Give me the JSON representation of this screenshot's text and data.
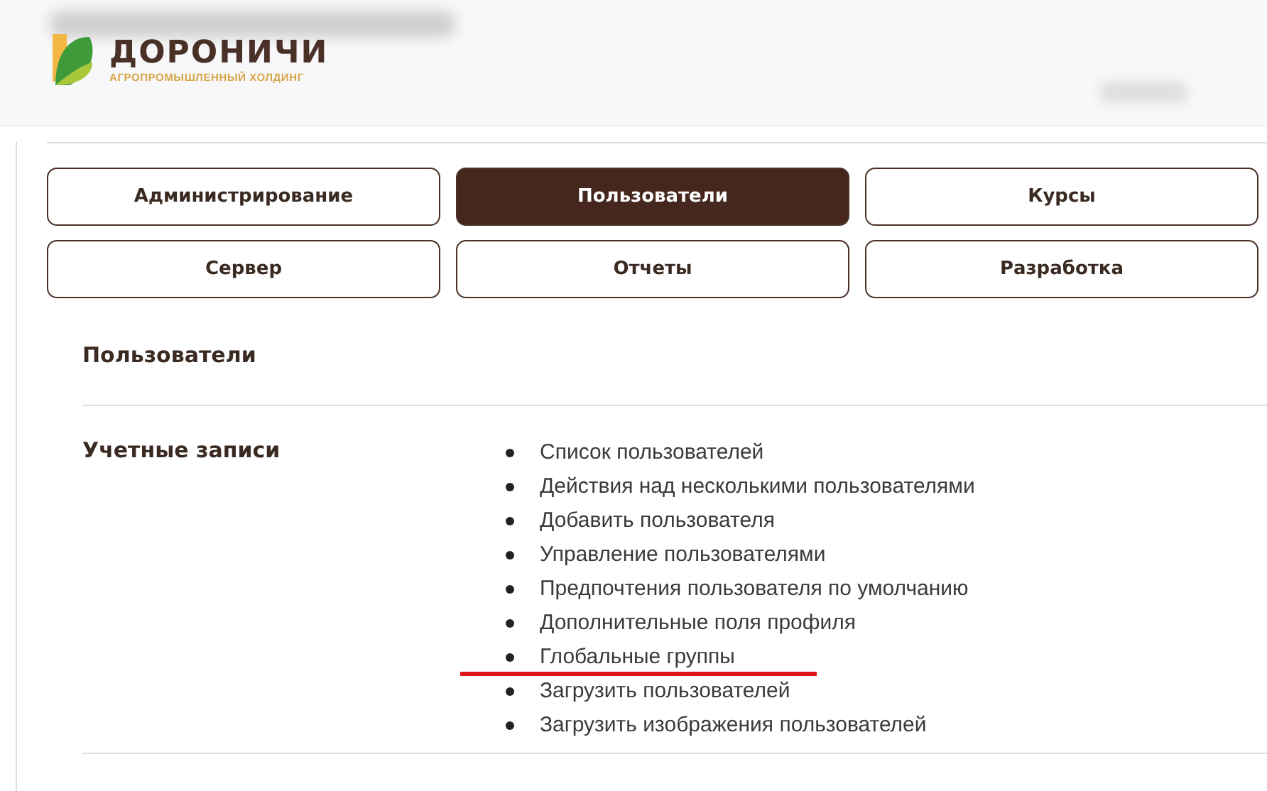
{
  "logo": {
    "name": "ДОРОНИЧИ",
    "tagline": "АГРОПРОМЫШЛЕННЫЙ ХОЛДИНГ"
  },
  "tabs": [
    {
      "label": "Администрирование",
      "selected": false
    },
    {
      "label": "Пользователи",
      "selected": true
    },
    {
      "label": "Курсы",
      "selected": false
    },
    {
      "label": "Сервер",
      "selected": false
    },
    {
      "label": "Отчеты",
      "selected": false
    },
    {
      "label": "Разработка",
      "selected": false
    }
  ],
  "page_title": "Пользователи",
  "section": {
    "title": "Учетные записи",
    "links": [
      {
        "label": "Список пользователей",
        "underlined": false
      },
      {
        "label": "Действия над несколькими пользователями",
        "underlined": false
      },
      {
        "label": "Добавить пользователя",
        "underlined": false
      },
      {
        "label": "Управление пользователями",
        "underlined": false
      },
      {
        "label": "Предпочтения пользователя по умолчанию",
        "underlined": false
      },
      {
        "label": "Дополнительные поля профиля",
        "underlined": false
      },
      {
        "label": "Глобальные группы",
        "underlined": true
      },
      {
        "label": "Загрузить пользователей",
        "underlined": false
      },
      {
        "label": "Загрузить изображения пользователей",
        "underlined": false
      }
    ]
  }
}
